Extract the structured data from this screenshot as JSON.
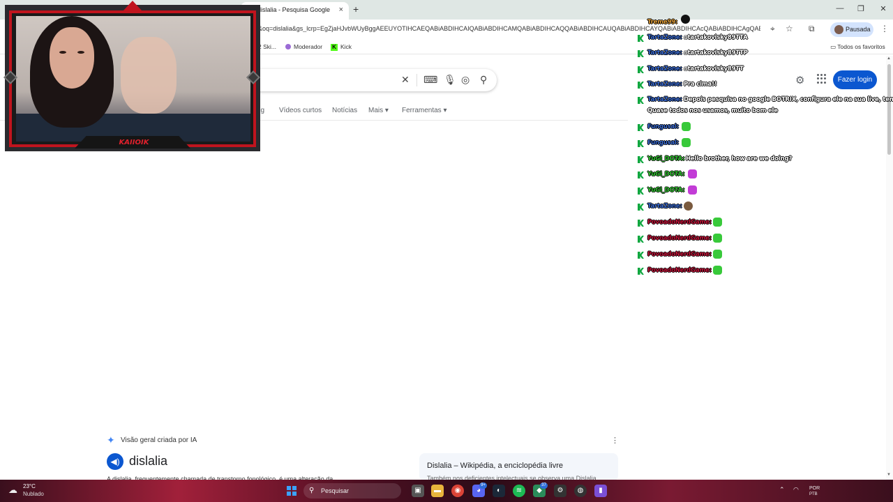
{
  "browser": {
    "tab_title": "dislalia - Pesquisa Google",
    "tab_close": "×",
    "new_tab": "+",
    "window_buttons": [
      "—",
      "❐",
      "✕"
    ],
    "url": "&oq=dislalia&gs_lcrp=EgZjaHJvbWUyBggAEEUYOTIHCAEQABiABDIHCAIQABiABDIHCAMQABiABDIHCAQQABiABDIHCAUQABiABDIHCAYQABiABDIHCAcQABiABDIHCAgQABiA...",
    "profile_label": "Pausada",
    "bookmarks": [
      {
        "label": "2 Ski..."
      },
      {
        "label": "Moderador"
      },
      {
        "label": "Kick"
      }
    ],
    "all_favorites": "Todos os favoritos"
  },
  "google": {
    "tabs": [
      "ng",
      "Vídeos curtos",
      "Notícias",
      "Mais",
      "Ferramentas"
    ],
    "login_button": "Fazer login",
    "ai_overview_title": "Visão geral criada por IA",
    "ai_term": "dislalia",
    "ai_body": "A dislalia, frequentemente chamada de transtorno fonológico, é uma alteração da...",
    "wiki_title": "Dislalia – Wikipédia, a enciclopédia livre",
    "wiki_snippet": "Também nos deficientes intelectuais se observa uma Dislalia..."
  },
  "chat": {
    "messages": [
      {
        "user": "Treme99:",
        "color": "#e6a23c",
        "text": ""
      },
      {
        "user": "TartaZone:",
        "color": "#3d6fd8",
        "text": "tartakovisky89TTA"
      },
      {
        "user": "TartaZone:",
        "color": "#3d6fd8",
        "text": "tartakovisky89TTP"
      },
      {
        "user": "TartaZone:",
        "color": "#3d6fd8",
        "text": "tartakovisky89TT"
      },
      {
        "user": "TartaZone:",
        "color": "#3d6fd8",
        "text": "Pra cima!!"
      },
      {
        "user": "TartaZone:",
        "color": "#3d6fd8",
        "text": "Depois pesquisa no google BOTRIX, configura ele na sua live, tem alguns"
      },
      {
        "user": "",
        "color": "#ffffff",
        "text": "Quase todos nos usamos, muito bom ele"
      },
      {
        "user": "Fungusal:",
        "color": "#3d6fd8",
        "text": ""
      },
      {
        "user": "Fungusal:",
        "color": "#3d6fd8",
        "text": ""
      },
      {
        "user": "YuGi_DOTA:",
        "color": "#33cc33",
        "text": "Hello brother, how are we doing?"
      },
      {
        "user": "YuGi_DOTA:",
        "color": "#33cc33",
        "text": ""
      },
      {
        "user": "YuGi_DOTA:",
        "color": "#33cc33",
        "text": ""
      },
      {
        "user": "TartaZone:",
        "color": "#3d6fd8",
        "text": ""
      },
      {
        "user": "PovoadoNerdGame:",
        "color": "#c9163c",
        "text": ""
      },
      {
        "user": "PovoadoNerdGame:",
        "color": "#c9163c",
        "text": ""
      },
      {
        "user": "PovoadoNerdGame:",
        "color": "#c9163c",
        "text": ""
      },
      {
        "user": "PovoadoNerdGame:",
        "color": "#c9163c",
        "text": ""
      }
    ]
  },
  "webcam": {
    "streamer_name": "KAIIOIK"
  },
  "taskbar": {
    "weather_temp": "23°C",
    "weather_cond": "Nublado",
    "search_label": "Pesquisar",
    "discord_badge": "9+",
    "steam_badge": "37",
    "lang": "POR",
    "lang2": "PTB"
  }
}
